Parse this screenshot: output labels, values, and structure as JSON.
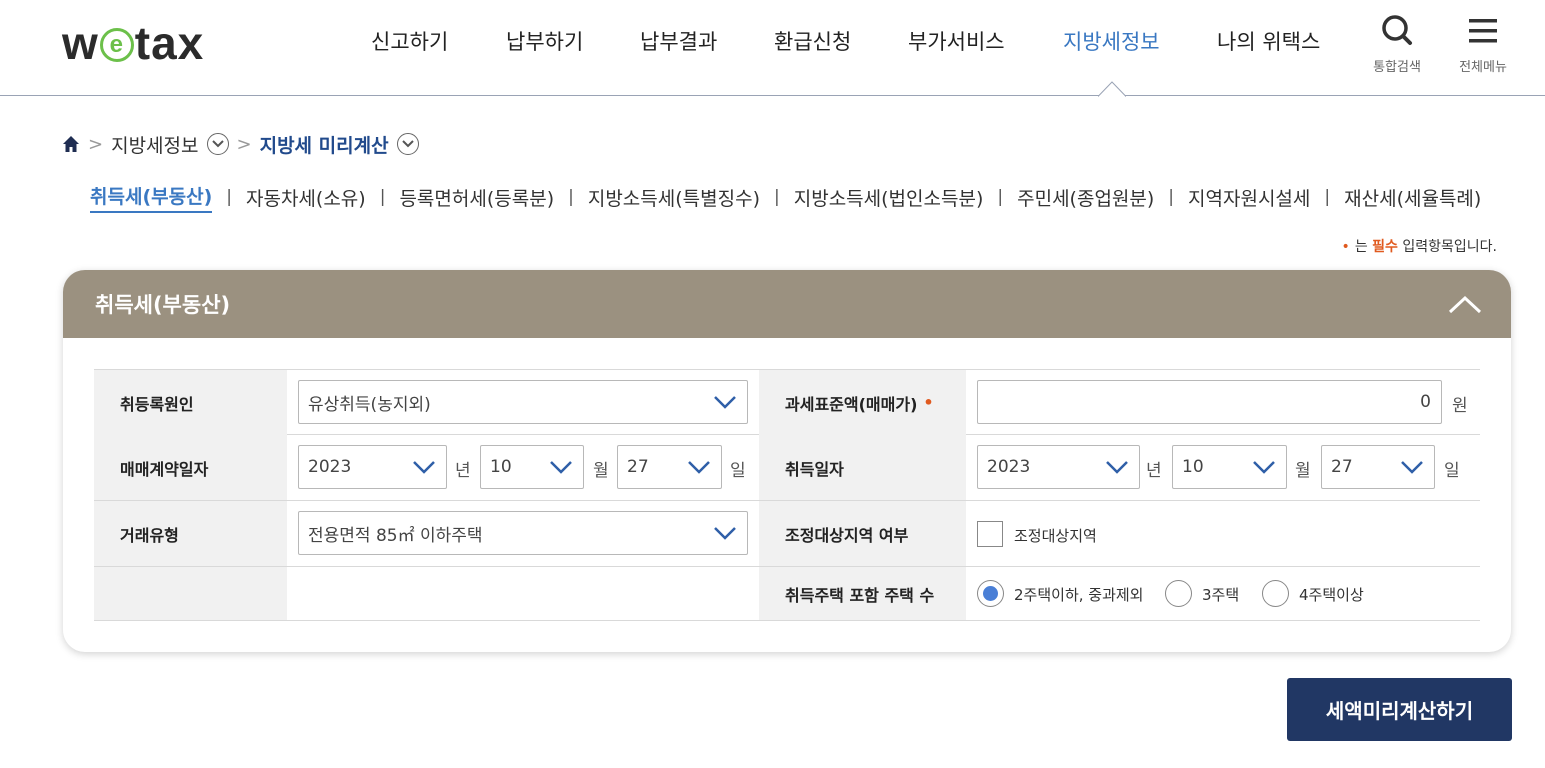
{
  "header": {
    "logo": {
      "pre": "w",
      "ring": "e",
      "post": "tax"
    },
    "nav": [
      "신고하기",
      "납부하기",
      "납부결과",
      "환급신청",
      "부가서비스",
      "지방세정보",
      "나의 위택스"
    ],
    "active_nav": "지방세정보",
    "search_label": "통합검색",
    "menu_label": "전체메뉴"
  },
  "breadcrumb": {
    "home_icon": "home-icon",
    "level1": "지방세정보",
    "level2": "지방세 미리계산"
  },
  "tabs": [
    "취득세(부동산)",
    "자동차세(소유)",
    "등록면허세(등록분)",
    "지방소득세(특별징수)",
    "지방소득세(법인소득분)",
    "주민세(종업원분)",
    "지역자원시설세",
    "재산세(세율특례)"
  ],
  "required_note": {
    "dot": "•",
    "prefix": "는",
    "emphasis": "필수",
    "suffix": "입력항목입니다."
  },
  "panel": {
    "title": "취득세(부동산)",
    "header_color": "#9b9180",
    "fields": {
      "acquisition_cause": {
        "label": "취등록원인",
        "value": "유상취득(농지외)"
      },
      "tax_base": {
        "label": "과세표준액(매매가)",
        "required_mark": "•",
        "value": "0",
        "unit": "원"
      },
      "contract_date": {
        "label": "매매계약일자",
        "year": "2023",
        "month": "10",
        "day": "27"
      },
      "acquisition_date": {
        "label": "취득일자",
        "year": "2023",
        "month": "10",
        "day": "27"
      },
      "date_units": {
        "year": "년",
        "month": "월",
        "day": "일"
      },
      "deal_type": {
        "label": "거래유형",
        "value": "전용면적 85㎡ 이하주택"
      },
      "regulated_area": {
        "label": "조정대상지역 여부",
        "checkbox_label": "조정대상지역",
        "checked": false
      },
      "house_count": {
        "label": "취득주택 포함 주택 수",
        "options": [
          "2주택이하, 중과제외",
          "3주택",
          "4주택이상"
        ],
        "selected": "2주택이하, 중과제외"
      }
    }
  },
  "calc_button": "세액미리계산하기",
  "colors": {
    "accent": "#3a78c2",
    "button": "#213764",
    "required": "#e05a1f",
    "radio_checked": "#4a7fd6"
  }
}
